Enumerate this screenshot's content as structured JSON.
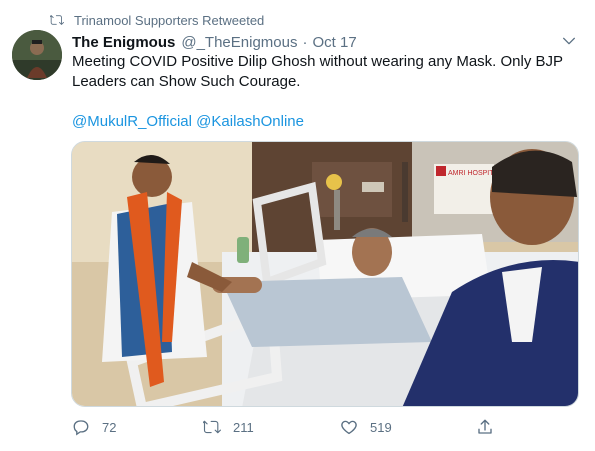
{
  "retweet_context": {
    "text": "Trinamool Supporters Retweeted"
  },
  "tweet": {
    "display_name": "The Enigmous",
    "handle": "@_TheEnigmous",
    "separator": "·",
    "date": "Oct 17",
    "text_line1": "Meeting COVID Positive Dilip Ghosh without wearing any Mask. Only BJP",
    "text_line2": "Leaders can Show Such Courage.",
    "mentions": [
      "@MukulR_Official",
      "@KailashOnline"
    ],
    "media_sign": "AMRI HOSPITAL"
  },
  "actions": {
    "reply_count": "72",
    "retweet_count": "211",
    "like_count": "519"
  },
  "colors": {
    "link": "#1b95e0",
    "muted": "#5b7083",
    "text": "#0f1419"
  },
  "icons": [
    "retweet-icon",
    "chevron-down-icon",
    "reply-icon",
    "retweet-icon",
    "heart-icon",
    "share-icon"
  ]
}
